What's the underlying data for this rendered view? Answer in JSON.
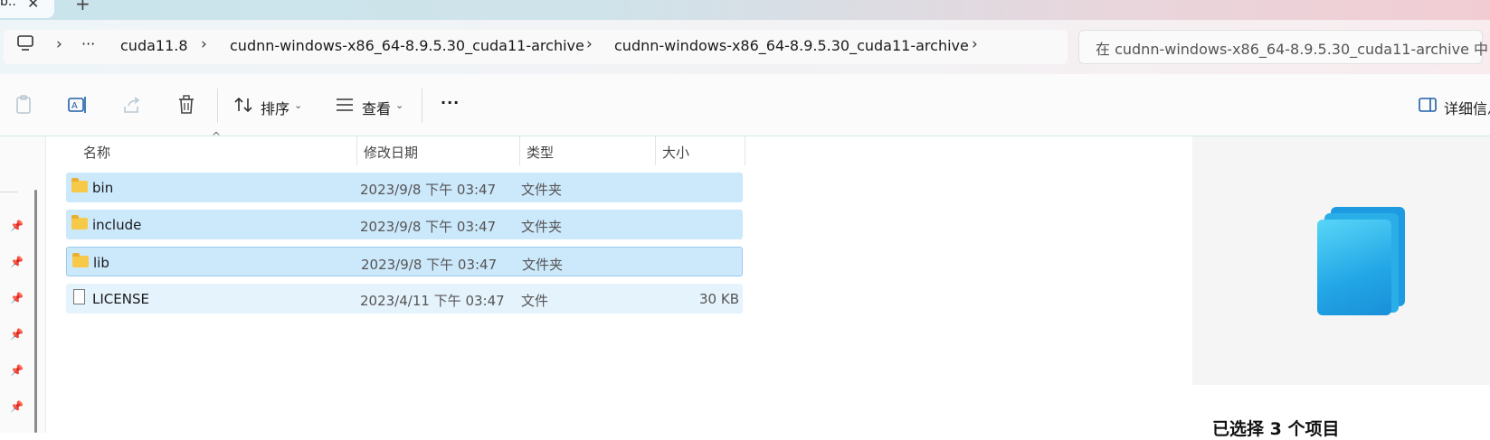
{
  "tab": {
    "title": "b..",
    "close_glyph": "✕",
    "new_tab_glyph": "+"
  },
  "address": {
    "overflow_glyph": "···",
    "crumbs": [
      "cuda11.8",
      "cudnn-windows-x86_64-8.9.5.30_cuda11-archive",
      "cudnn-windows-x86_64-8.9.5.30_cuda11-archive"
    ],
    "search_placeholder": "在 cudnn-windows-x86_64-8.9.5.30_cuda11-archive 中"
  },
  "toolbar": {
    "sort_label": "排序",
    "view_label": "查看",
    "more_glyph": "···",
    "details_label": "详细信息"
  },
  "columns": {
    "name": "名称",
    "date": "修改日期",
    "type": "类型",
    "size": "大小"
  },
  "files": [
    {
      "name": "bin",
      "date": "2023/9/8 下午 03:47",
      "type": "文件夹",
      "size": ""
    },
    {
      "name": "include",
      "date": "2023/9/8 下午 03:47",
      "type": "文件夹",
      "size": ""
    },
    {
      "name": "lib",
      "date": "2023/9/8 下午 03:47",
      "type": "文件夹",
      "size": ""
    },
    {
      "name": "LICENSE",
      "date": "2023/4/11 下午 03:47",
      "type": "文件",
      "size": "30 KB"
    }
  ],
  "details_pane": {
    "title": "已选择 3 个项目"
  },
  "colors": {
    "selection": "#cce8fb",
    "accent": "#0a74d6",
    "folder": "#f7c948"
  }
}
